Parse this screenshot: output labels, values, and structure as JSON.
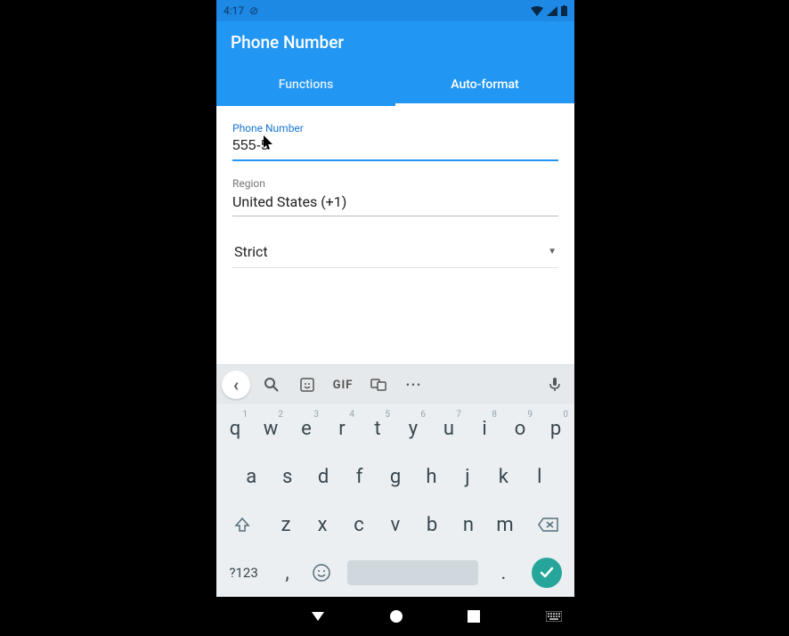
{
  "statusbar": {
    "time": "4:17",
    "icons": {
      "dnd": "⊘",
      "wifi": "▾",
      "signal": "◢",
      "battery": "▮"
    }
  },
  "appbar": {
    "title": "Phone Number"
  },
  "tabs": [
    {
      "label": "Functions",
      "active": false
    },
    {
      "label": "Auto-format",
      "active": true
    }
  ],
  "form": {
    "phone_label": "Phone Number",
    "phone_value": "555-5",
    "region_label": "Region",
    "region_value": "United States (+1)",
    "dropdown_value": "Strict"
  },
  "keyboard": {
    "suggestion_icons": {
      "back": "‹",
      "search": "search",
      "sticker": "sticker",
      "gif": "GIF",
      "translate": "translate",
      "more": "•••",
      "mic": "mic"
    },
    "row1": [
      {
        "k": "q",
        "s": "1"
      },
      {
        "k": "w",
        "s": "2"
      },
      {
        "k": "e",
        "s": "3"
      },
      {
        "k": "r",
        "s": "4"
      },
      {
        "k": "t",
        "s": "5"
      },
      {
        "k": "y",
        "s": "6"
      },
      {
        "k": "u",
        "s": "7"
      },
      {
        "k": "i",
        "s": "8"
      },
      {
        "k": "o",
        "s": "9"
      },
      {
        "k": "p",
        "s": "0"
      }
    ],
    "row2": [
      "a",
      "s",
      "d",
      "f",
      "g",
      "h",
      "j",
      "k",
      "l"
    ],
    "row3": [
      "z",
      "x",
      "c",
      "v",
      "b",
      "n",
      "m"
    ],
    "symbols_label": "?123",
    "comma": ",",
    "period": "."
  },
  "navbar": {
    "back": "back",
    "home": "home",
    "recents": "recents",
    "kbd": "kbd"
  }
}
